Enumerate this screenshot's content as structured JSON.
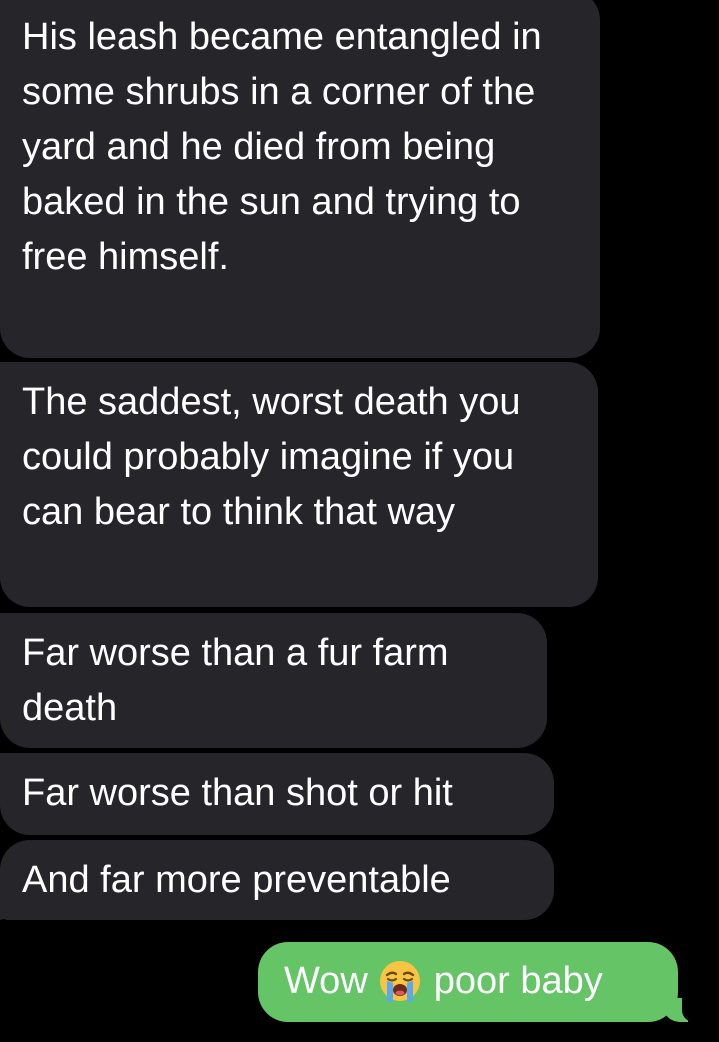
{
  "thread": {
    "incoming": [
      "His leash became entangled in some shrubs in a corner of the yard and he died from being baked in the sun and trying to free himself.",
      "The saddest, worst death you could probably imagine if you can bear to think that way",
      "Far worse than a fur farm death",
      "Far worse than shot or hit",
      "And far more preventable"
    ],
    "outgoing": {
      "before_emoji": "Wow",
      "emoji": "loudly-crying-face",
      "after_emoji": "poor baby"
    }
  },
  "colors": {
    "background": "#000000",
    "incoming_bubble": "#262529",
    "outgoing_bubble": "#64c466",
    "text": "#ffffff"
  }
}
